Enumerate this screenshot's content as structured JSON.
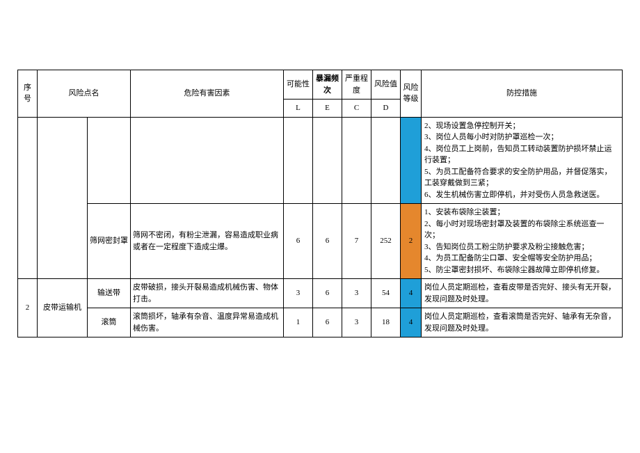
{
  "headers": {
    "seq": "序号",
    "risk_point": "风险点名",
    "factor": "危险有害因素",
    "possibility": "可能性",
    "exposure": "暴漏频次",
    "severity": "严重程度",
    "risk_value": "风险值",
    "risk_level": "风险等级",
    "measure": "防控措施",
    "L": "L",
    "E": "E",
    "C": "C",
    "D": "D"
  },
  "rows": [
    {
      "seq": "",
      "risk_point": "",
      "sub": "",
      "factor": "",
      "L": "",
      "E": "",
      "C": "",
      "D": "",
      "level": "",
      "level_color": "blue",
      "measure": "2、现场设置急停控制开关；\n3、岗位人员每小时对防护罩巡检一次；\n4、岗位员工上岗前，告知员工转动装置防护损坏禁止运行装置；\n5、为员工配备符合要求的安全防护用品，并督促落实，工装穿戴做到三紧；\n6、发生机械伤害立即停机，并对受伤人员急救送医。"
    },
    {
      "seq": "",
      "risk_point": "",
      "sub": "筛网密封罩",
      "factor": "筛网不密闭，有粉尘泄漏，容易造成职业病或者在一定程度下造成尘爆。",
      "L": "6",
      "E": "6",
      "C": "7",
      "D": "252",
      "level": "2",
      "level_color": "orange",
      "measure": "1、安装布袋除尘装置；\n2、每小时对现场密封罩及装置的布袋除尘系统巡查一次；\n3、告知岗位员工粉尘防护要求及粉尘接触危害；\n4、为员工配备防尘口罩、安全帽等安全防护用品；\n5、防尘罩密封损坏、布袋除尘器故障立即停机修复。"
    },
    {
      "seq": "2",
      "risk_point": "皮带运输机",
      "sub": "输送带",
      "factor": "皮带破损，接头开裂易造成机械伤害、物体打击。",
      "L": "3",
      "E": "6",
      "C": "3",
      "D": "54",
      "level": "4",
      "level_color": "blue",
      "measure": "岗位人员定期巡检，查看皮带是否完好、接头有无开裂，发现问题及时处理。"
    },
    {
      "seq": "",
      "risk_point": "",
      "sub": "滚筒",
      "factor": "滚筒损坏，轴承有杂音、温度异常易造成机械伤害。",
      "L": "1",
      "E": "6",
      "C": "3",
      "D": "18",
      "level": "4",
      "level_color": "blue",
      "measure": "岗位人员定期巡检，查看滚筒是否完好、轴承有无杂音，发现问题及时处理。"
    }
  ]
}
